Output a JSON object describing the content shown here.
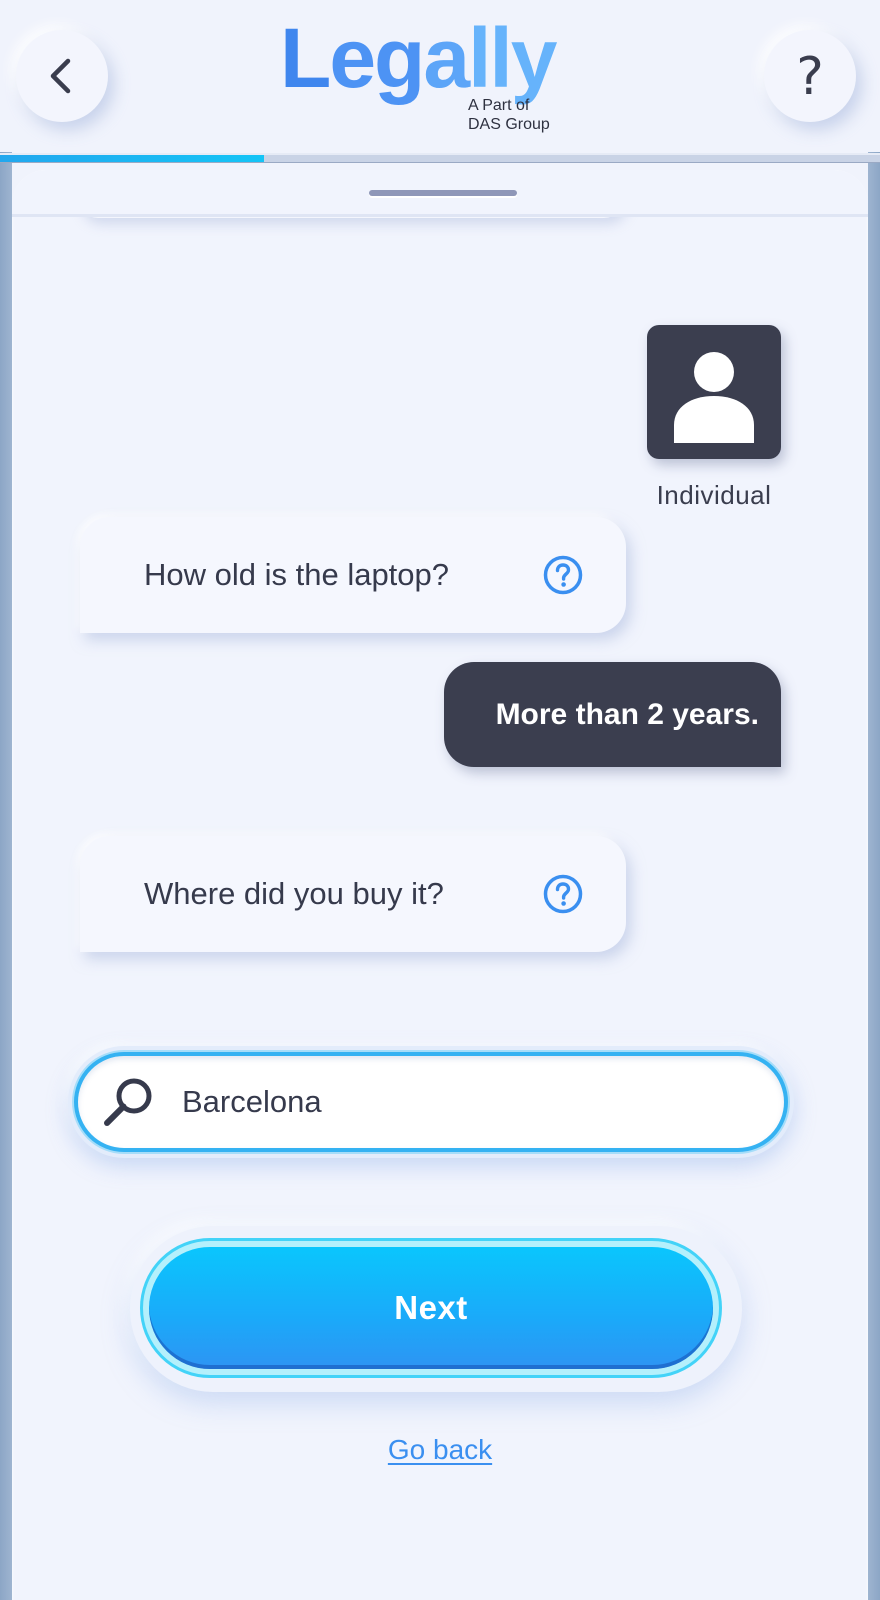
{
  "header": {
    "back_icon": "chevron-left-icon",
    "help_label": "?",
    "logo": {
      "word_parts": [
        "L",
        "eg",
        "a",
        "lly"
      ],
      "sub_line1": "A Part of",
      "sub_line2": "DAS Group"
    },
    "progress_fraction": 0.3
  },
  "chat": {
    "user_choice": {
      "icon": "person-icon",
      "label": "Individual"
    },
    "questions": [
      {
        "text": "How old is the laptop?",
        "help_icon": "question-circle-icon"
      },
      {
        "text": "Where did you buy it?",
        "help_icon": "question-circle-icon"
      }
    ],
    "answers": [
      {
        "text": "More than 2 years."
      }
    ]
  },
  "search": {
    "icon": "search-icon",
    "value": "Barcelona"
  },
  "actions": {
    "next_label": "Next",
    "go_back_label": "Go back"
  },
  "colors": {
    "accent": "#4a8ef2",
    "button_gradient_top": "#0ac6fd",
    "button_gradient_bottom": "#2e94f3",
    "dark_bubble": "#3b3e4f",
    "background": "#f0f3fc"
  }
}
